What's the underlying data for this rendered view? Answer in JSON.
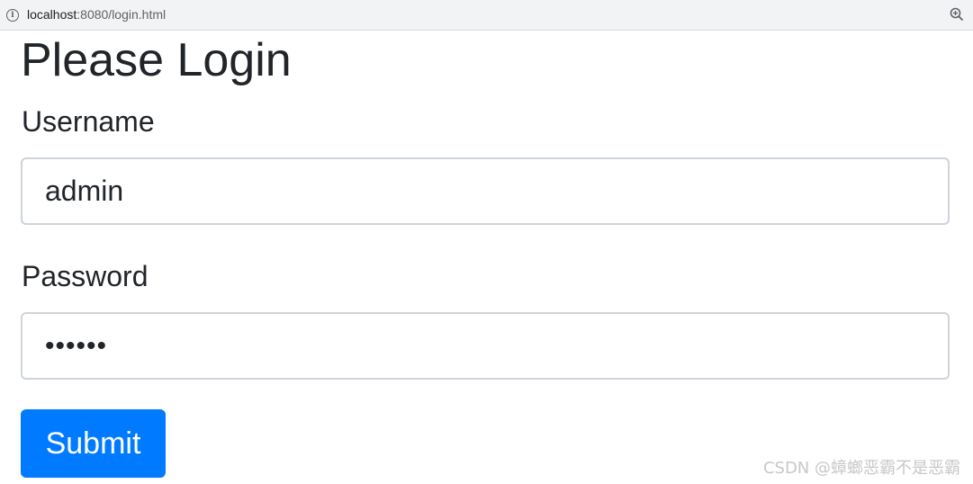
{
  "browser": {
    "url_host": "localhost",
    "url_rest": ":8080/login.html",
    "info_icon": "info-icon",
    "zoom_icon": "zoom-in-icon"
  },
  "form": {
    "title": "Please Login",
    "username_label": "Username",
    "username_value": "admin",
    "password_label": "Password",
    "password_value": "••••••",
    "submit_label": "Submit"
  },
  "colors": {
    "primary": "#007bff",
    "input_border": "#ced4da",
    "text": "#212529"
  },
  "watermark": "CSDN @蟑螂恶霸不是恶霸"
}
